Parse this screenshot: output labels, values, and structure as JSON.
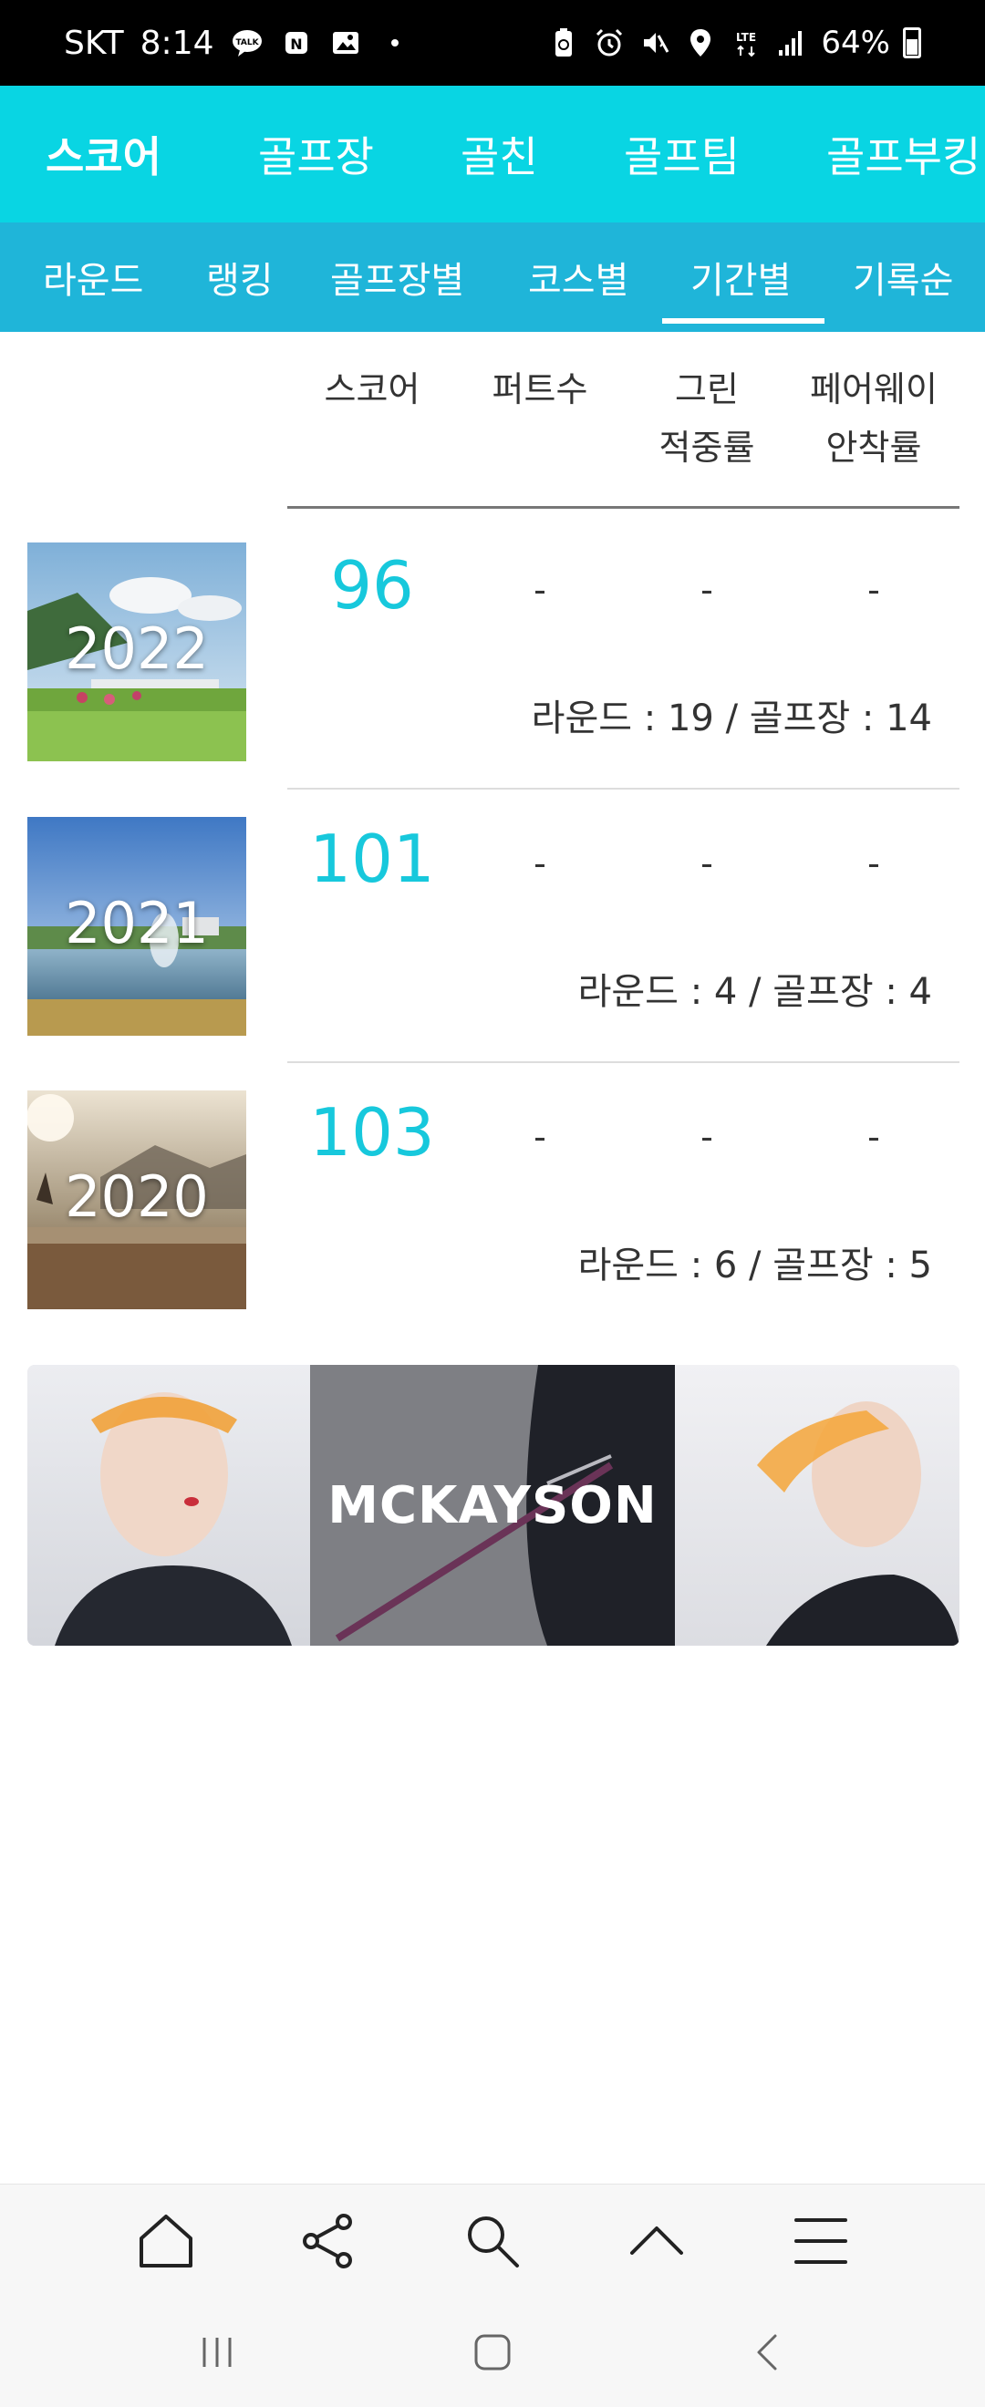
{
  "status_bar": {
    "carrier": "SKT",
    "time": "8:14",
    "notification_icons": [
      "talk-icon",
      "naver-icon",
      "image-icon",
      "dot-icon"
    ],
    "system_icons": [
      "battery-saver-icon",
      "alarm-icon",
      "mute-icon",
      "location-icon",
      "lte-icon",
      "signal-icon"
    ],
    "battery": "64%"
  },
  "top_nav": {
    "tabs": [
      {
        "label": "스코어",
        "active": true
      },
      {
        "label": "골프장",
        "active": false
      },
      {
        "label": "골친",
        "active": false
      },
      {
        "label": "골프팀",
        "active": false
      },
      {
        "label": "골프부킹",
        "active": false
      }
    ]
  },
  "sub_nav": {
    "tabs": [
      {
        "label": "라운드",
        "active": false
      },
      {
        "label": "랭킹",
        "active": false
      },
      {
        "label": "골프장별",
        "active": false
      },
      {
        "label": "코스별",
        "active": false
      },
      {
        "label": "기간별",
        "active": true
      },
      {
        "label": "기록순",
        "active": false
      }
    ]
  },
  "table": {
    "headers": {
      "score": "스코어",
      "putts": "퍼트수",
      "green_line1": "그린",
      "green_line2": "적중률",
      "fairway_line1": "페어웨이",
      "fairway_line2": "안착률"
    },
    "rows": [
      {
        "year": "2022",
        "score": "96",
        "putts": "-",
        "green": "-",
        "fairway": "-",
        "summary": "라운드 : 19 / 골프장 : 14"
      },
      {
        "year": "2021",
        "score": "101",
        "putts": "-",
        "green": "-",
        "fairway": "-",
        "summary": "라운드 : 4 / 골프장 : 4"
      },
      {
        "year": "2020",
        "score": "103",
        "putts": "-",
        "green": "-",
        "fairway": "-",
        "summary": "라운드 : 6 / 골프장 : 5"
      }
    ]
  },
  "ad": {
    "brand": "MCKAYSON"
  },
  "browser_toolbar": {
    "buttons": [
      "home-icon",
      "share-icon",
      "search-icon",
      "scroll-top-icon",
      "menu-icon"
    ]
  },
  "system_nav": {
    "buttons": [
      "recent-apps-icon",
      "home-button-icon",
      "back-icon"
    ]
  },
  "colors": {
    "top_nav_bg": "#09d5e3",
    "sub_nav_bg": "#1fb5d9",
    "score_text": "#17c8dc"
  }
}
